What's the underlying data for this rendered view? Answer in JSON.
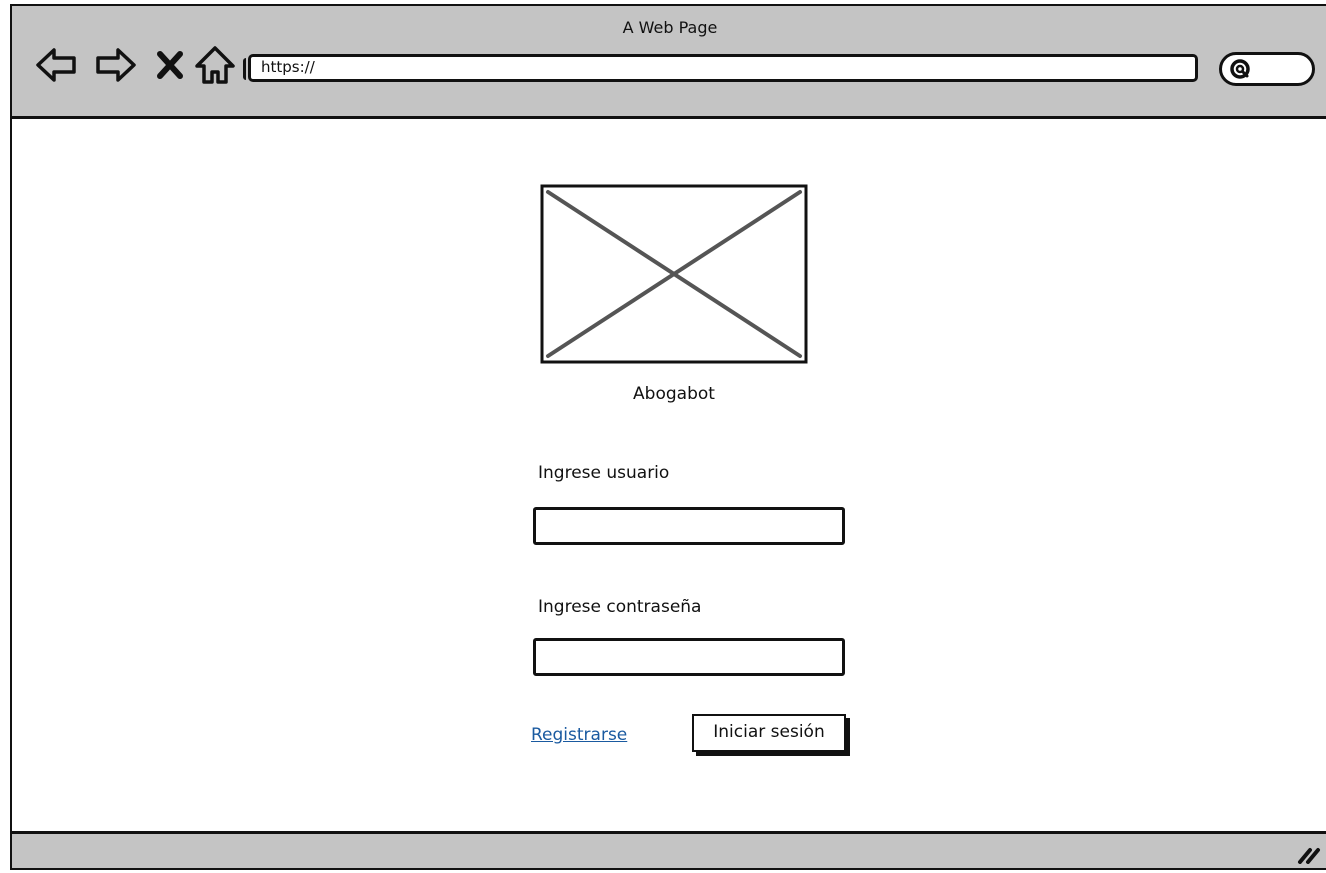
{
  "window": {
    "title": "A Web Page",
    "url": "https://"
  },
  "icons": {
    "back": "back-arrow-icon",
    "forward": "forward-arrow-icon",
    "stop": "close-icon",
    "home": "home-icon",
    "search": "search-icon",
    "resize": "resize-grip-icon",
    "logo": "image-placeholder-icon"
  },
  "login": {
    "brand": "Abogabot",
    "username_label": "Ingrese usuario",
    "username_value": "",
    "password_label": "Ingrese contraseña",
    "password_value": "",
    "register_link": "Registrarse",
    "submit_button": "Iniciar sesión"
  },
  "colors": {
    "chrome": "#c4c4c4",
    "link": "#1a5aa0",
    "ink": "#111111"
  }
}
